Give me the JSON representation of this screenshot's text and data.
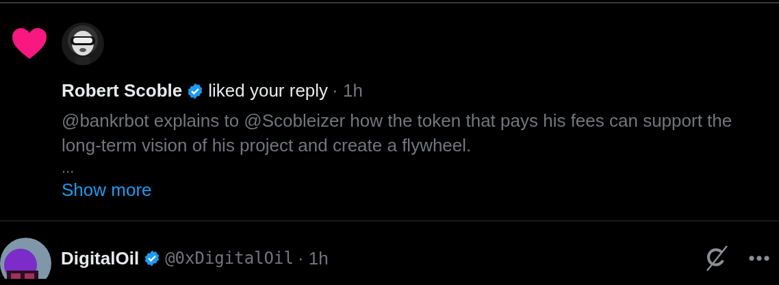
{
  "notification": {
    "liked": true,
    "user_name": "Robert Scoble",
    "verified": true,
    "action": "liked your reply",
    "time": "· 1h",
    "text": "@bankrbot explains to @Scobleizer how the token that pays his fees can support the long-term vision of his project and create a flywheel.",
    "ellipsis": "...",
    "show_more": "Show more"
  },
  "post": {
    "user_name": "DigitalOil",
    "verified": true,
    "handle": "@0xDigitalOil",
    "time": "· 1h"
  }
}
